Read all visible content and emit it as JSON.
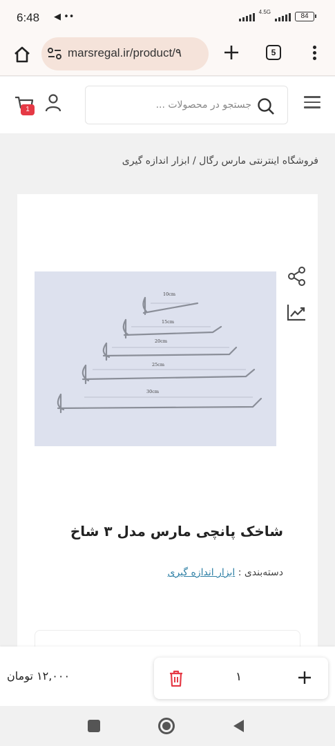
{
  "status_bar": {
    "time": "6:48",
    "network": "4.5G",
    "battery": "84"
  },
  "browser": {
    "url": "marsregal.ir/product/٩",
    "tab_count": "5"
  },
  "header": {
    "search_placeholder": "جستجو در محصولات ...",
    "cart_count": "1"
  },
  "breadcrumb": {
    "home": "فروشگاه اینترنتی مارس رگال",
    "separator": " / ",
    "current": "ابزار اندازه گیری"
  },
  "product": {
    "title": "شاخک پانچی مارس مدل ۳ شاخ",
    "category_label": "دسته‌بندی : ",
    "category_link": "ابزار اندازه گیری",
    "image_labels": [
      "10cm",
      "15cm",
      "20cm",
      "25cm",
      "30cm"
    ]
  },
  "purchase": {
    "price": "۱۲,۰۰۰ تومان",
    "quantity": "۱"
  },
  "colors": {
    "badge": "#e53945",
    "link": "#2d7fa5",
    "trash": "#e53945",
    "url_pill": "#f5e3da"
  }
}
